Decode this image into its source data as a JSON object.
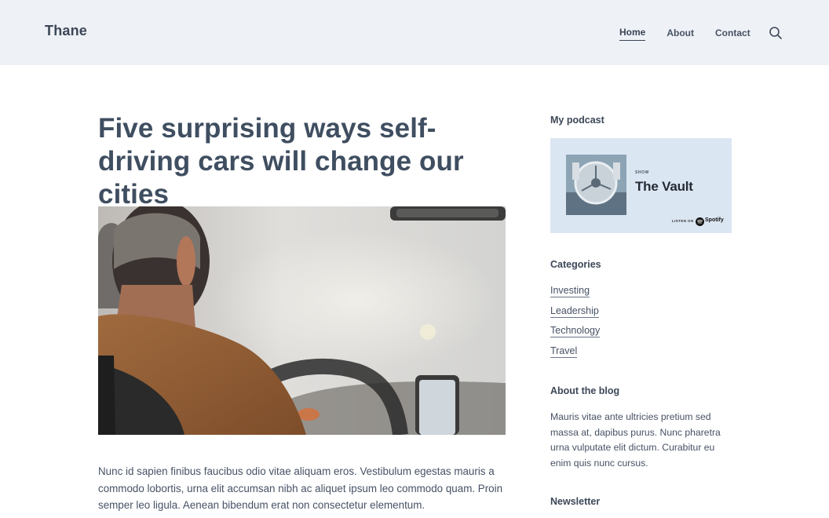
{
  "header": {
    "brand": "Thane",
    "nav": [
      {
        "label": "Home",
        "active": true
      },
      {
        "label": "About",
        "active": false
      },
      {
        "label": "Contact",
        "active": false
      }
    ],
    "search_icon": "search-icon"
  },
  "post": {
    "title": "Five surprising ways self-driving cars will change our cities",
    "image_alt": "person driving a car",
    "excerpt": "Nunc id sapien finibus faucibus odio vitae aliquam eros. Vestibulum egestas mauris a commodo lobortis, urna elit accumsan nibh ac aliquet ipsum leo commodo quam. Proin semper leo ligula. Aenean bibendum erat non consectetur elementum."
  },
  "sidebar": {
    "podcast": {
      "heading": "My podcast",
      "show_label": "SHOW",
      "name": "The Vault",
      "listen_label": "LISTEN ON",
      "platform": "Spotify"
    },
    "categories": {
      "heading": "Categories",
      "items": [
        "Investing",
        "Leadership",
        "Technology",
        "Travel"
      ]
    },
    "about": {
      "heading": "About the blog",
      "text": "Mauris vitae ante ultricies pretium sed massa at, dapibus purus. Nunc pharetra urna vulputate elit dictum. Curabitur eu enim quis nunc cursus."
    },
    "newsletter": {
      "heading": "Newsletter"
    }
  },
  "colors": {
    "header_bg": "#eef1f6",
    "text": "#3f4a5a",
    "podcast_bg": "#dbe6f3"
  }
}
